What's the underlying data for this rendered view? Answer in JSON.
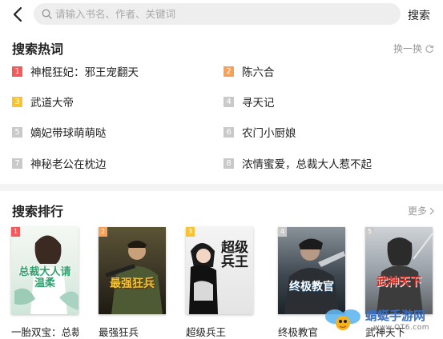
{
  "search": {
    "placeholder": "请输入书名、作者、关键词",
    "button_label": "搜索"
  },
  "hot": {
    "title": "搜索热词",
    "refresh_label": "换一换",
    "items": [
      {
        "rank": "1",
        "label": "神棍狂妃：邪王宠翻天",
        "color": "#f15b5b"
      },
      {
        "rank": "2",
        "label": "陈六合",
        "color": "#f6a05a"
      },
      {
        "rank": "3",
        "label": "武道大帝",
        "color": "#f7c330"
      },
      {
        "rank": "4",
        "label": "寻天记",
        "color": "#c9c9c9"
      },
      {
        "rank": "5",
        "label": "嫡妃带球萌萌哒",
        "color": "#c9c9c9"
      },
      {
        "rank": "6",
        "label": "农门小厨娘",
        "color": "#c9c9c9"
      },
      {
        "rank": "7",
        "label": "神秘老公在枕边",
        "color": "#c9c9c9"
      },
      {
        "rank": "8",
        "label": "浓情蜜爱，总裁大人惹不起",
        "color": "#c9c9c9"
      }
    ]
  },
  "ranking": {
    "title": "搜索排行",
    "more_label": "更多",
    "books": [
      {
        "rank": "1",
        "title": "一胎双宝：总裁",
        "cover_text": "总裁大人请温柔",
        "badge_color": "#f15b5b"
      },
      {
        "rank": "2",
        "title": "最强狂兵",
        "cover_text": "最强狂兵",
        "badge_color": "#f6a05a"
      },
      {
        "rank": "3",
        "title": "超级兵王",
        "cover_text": "超级兵王",
        "badge_color": "#f7c330"
      },
      {
        "rank": "4",
        "title": "终极教官",
        "cover_text": "终极教官",
        "badge_color": "#c9c9c9"
      },
      {
        "rank": "5",
        "title": "武神天下",
        "cover_text": "武神天下",
        "badge_color": "#c9c9c9"
      }
    ]
  },
  "watermark": {
    "name": "蜻蜓手游网",
    "url": "www.QT6.com"
  }
}
